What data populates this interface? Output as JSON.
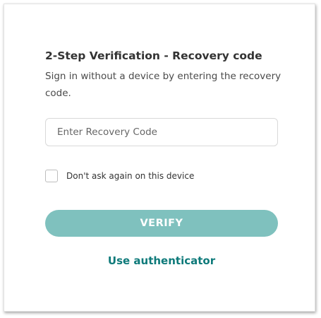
{
  "verification": {
    "title": "2-Step Verification - Recovery code",
    "description": "Sign in without a device by entering the recovery code.",
    "recovery_input": {
      "value": "",
      "placeholder": "Enter Recovery Code"
    },
    "remember_checkbox": {
      "label": "Don't ask again on this device",
      "checked": false
    },
    "verify_button_label": "VERIFY",
    "alternate_link_label": "Use authenticator"
  },
  "colors": {
    "accent": "#7fc1be",
    "link": "#0e7a7a",
    "title_text": "#333333"
  }
}
